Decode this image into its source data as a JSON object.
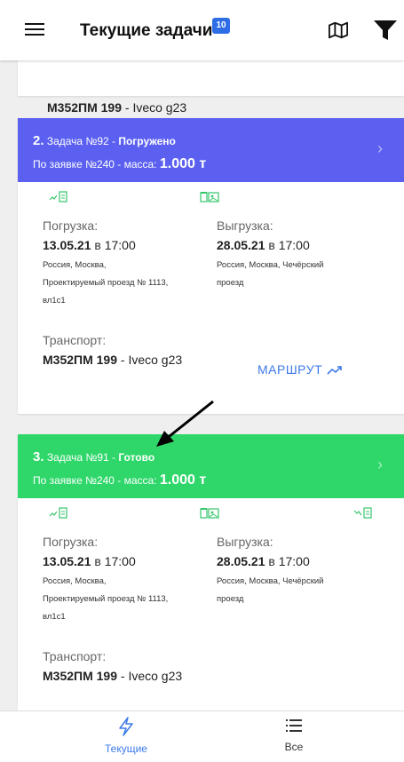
{
  "header": {
    "title": "Текущие задачи",
    "badge": "10",
    "icons": [
      "menu-icon",
      "map-icon",
      "filter-icon"
    ]
  },
  "cards": [
    {
      "transport_plate": "М352ПМ 199",
      "transport_model": " - Iveco g23"
    },
    {
      "number": "2.",
      "task": " Задача №92 - ",
      "status": "Погружено",
      "order": "По заявке №240 - масса: ",
      "mass": "1.000 т",
      "loading_label": "Погрузка:",
      "loading_date": "13.05.21",
      "loading_at": " в ",
      "loading_time": "17:00",
      "loading_addr1": "Россия, Москва,",
      "loading_addr2": "Проектируемый проезд № 1113,",
      "loading_addr3": "вл1с1",
      "unloading_label": "Выгрузка:",
      "unloading_date": "28.05.21",
      "unloading_at": " в ",
      "unloading_time": "17:00",
      "unloading_addr1": "Россия, Москва, Чечёрский",
      "unloading_addr2": "проезд",
      "transport_label": "Транспорт:",
      "transport_plate": "М352ПМ 199",
      "transport_model": " - Iveco g23",
      "route_label": "МАРШРУТ",
      "color": "#5b60f0"
    },
    {
      "number": "3.",
      "task": " Задача №91 - ",
      "status": "Готово",
      "order": "По заявке №240 - масса: ",
      "mass": "1.000 т",
      "loading_label": "Погрузка:",
      "loading_date": "13.05.21",
      "loading_at": " в ",
      "loading_time": "17:00",
      "loading_addr1": "Россия, Москва,",
      "loading_addr2": "Проектируемый проезд № 1113,",
      "loading_addr3": "вл1с1",
      "unloading_label": "Выгрузка:",
      "unloading_date": "28.05.21",
      "unloading_at": " в ",
      "unloading_time": "17:00",
      "unloading_addr1": "Россия, Москва, Чечёрский",
      "unloading_addr2": "проезд",
      "transport_label": "Транспорт:",
      "transport_plate": "М352ПМ 199",
      "transport_model": " - Iveco g23",
      "color": "#2fd76a"
    }
  ],
  "bottom_nav": {
    "current": "Текущие",
    "all": "Все"
  }
}
